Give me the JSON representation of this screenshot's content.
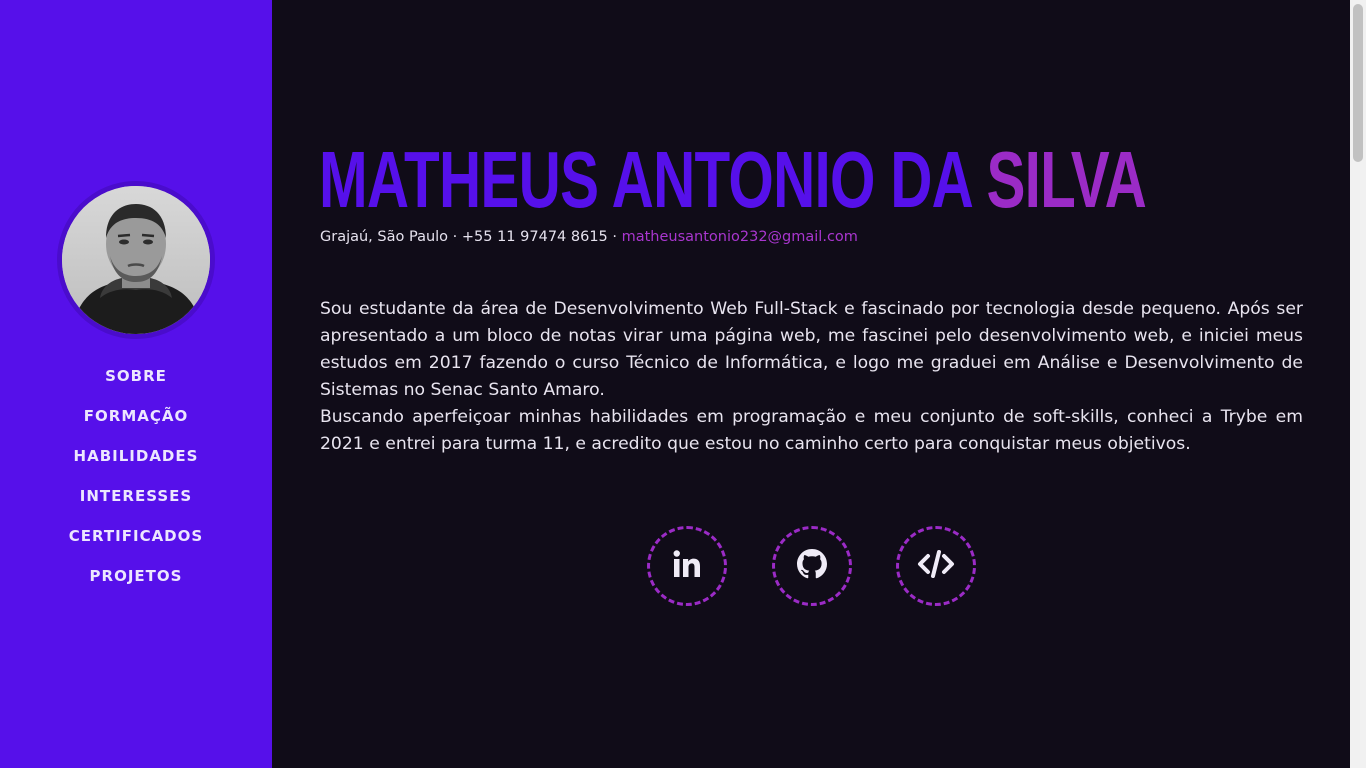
{
  "sidebar": {
    "avatar_alt": "Matheus Antonio da Silva",
    "nav": [
      {
        "label": "SOBRE"
      },
      {
        "label": "FORMAÇÃO"
      },
      {
        "label": "HABILIDADES"
      },
      {
        "label": "INTERESSES"
      },
      {
        "label": "CERTIFICADOS"
      },
      {
        "label": "PROJETOS"
      }
    ]
  },
  "header": {
    "name_first": "MATHEUS ANTONIO DA ",
    "name_last": "SILVA",
    "location": "Grajaú, São Paulo",
    "separator": " · ",
    "phone": "+55 11 97474 8615",
    "email": "matheusantonio232@gmail.com"
  },
  "bio": {
    "paragraph_1": "Sou estudante da área de Desenvolvimento Web Full-Stack e fascinado por tecnologia desde pequeno. Após ser apresentado a um bloco de notas virar uma página web, me fascinei pelo desenvolvimento web, e iniciei meus estudos em 2017 fazendo o curso Técnico de Informática, e logo me graduei em Análise e Desenvolvimento de Sistemas no Senac Santo Amaro.",
    "paragraph_2": "Buscando aperfeiçoar minhas habilidades em programação e meu conjunto de soft-skills, conheci a Trybe em 2021 e entrei para turma 11, e acredito que estou no caminho certo para conquistar meus objetivos."
  },
  "socials": [
    {
      "icon": "linkedin-icon"
    },
    {
      "icon": "github-icon"
    },
    {
      "icon": "code-icon"
    }
  ],
  "colors": {
    "sidebar_bg": "#5610ea",
    "page_bg": "#100c18",
    "accent_purple": "#9b2bc6",
    "name_blue": "#5610ea"
  }
}
